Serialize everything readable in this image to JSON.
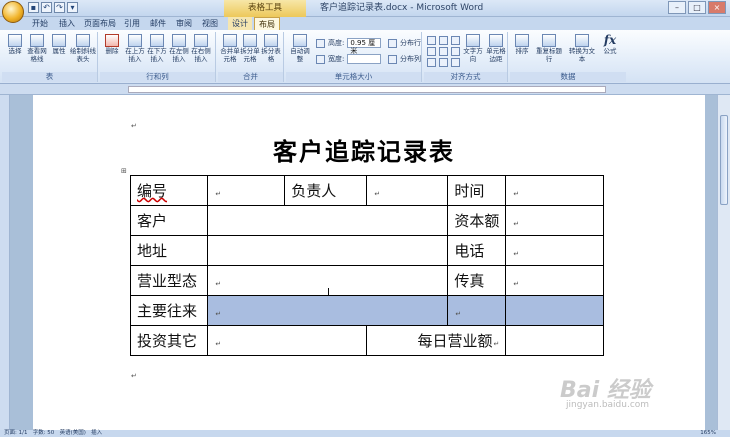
{
  "window": {
    "tool_tab_title": "表格工具",
    "doc_title": "客户追踪记录表.docx - Microsoft Word"
  },
  "tabs": [
    "开始",
    "插入",
    "页面布局",
    "引用",
    "邮件",
    "审阅",
    "视图",
    "设计",
    "布局"
  ],
  "ribbon": {
    "groups": [
      "表",
      "行和列",
      "合并",
      "单元格大小",
      "对齐方式",
      "数据"
    ],
    "table_group": {
      "select": "选择",
      "gridlines": "查看网格线",
      "properties": "属性",
      "draw_diagonal": "绘制斜线表头"
    },
    "rowcol_group": {
      "delete": "删除",
      "insert_above": "在上方插入",
      "insert_below": "在下方插入",
      "insert_left": "在左侧插入",
      "insert_right": "在右侧插入"
    },
    "merge_group": {
      "merge": "合并单元格",
      "split_cells": "拆分单元格",
      "split_table": "拆分表格"
    },
    "size_group": {
      "autofit": "自动调整",
      "height_label": "高度:",
      "height_value": "0.95 厘米",
      "width_label": "宽度:",
      "width_value": "",
      "dist_rows": "分布行",
      "dist_cols": "分布列"
    },
    "align_group": {
      "text_direction": "文字方向",
      "cell_margins": "单元格边距"
    },
    "data_group": {
      "sort": "排序",
      "repeat_header": "重复标题行",
      "convert": "转换为文本",
      "formula": "公式",
      "formula_icon": "fx"
    }
  },
  "document": {
    "heading": "客户追踪记录表",
    "table": {
      "r1": {
        "c1": "编号",
        "c3": "负责人",
        "c5": "时间"
      },
      "r2": {
        "c1": "客户",
        "c3": "资本额"
      },
      "r3": {
        "c1": "地址",
        "c3": "电话"
      },
      "r4": {
        "c1": "营业型态",
        "c3": "传真"
      },
      "r5": {
        "c1": "主要往来"
      },
      "r6": {
        "c1": "投资其它",
        "c3": "每日营业额"
      }
    }
  },
  "status": {
    "page": "页面: 1/1",
    "words": "字数: 50",
    "lang": "英语(美国)",
    "mode": "插入",
    "zoom": "165%"
  },
  "watermark": {
    "main": "Bai 经验",
    "sub": "jingyan.baidu.com"
  }
}
